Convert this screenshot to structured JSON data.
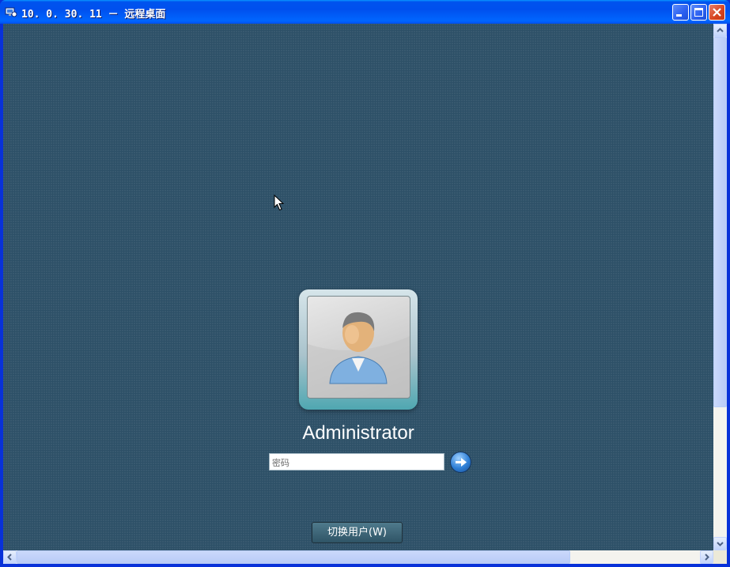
{
  "window": {
    "title": "10. 0. 30. 11 － 远程桌面",
    "icon": "remote-desktop-icon",
    "controls": [
      "minimize-icon",
      "maximize-icon",
      "close-icon"
    ]
  },
  "login": {
    "username": "Administrator",
    "password_placeholder": "密码",
    "password_value": "",
    "submit_icon": "arrow-right-icon",
    "switch_user_label": "切换用户(W)",
    "avatar_icon": "user-avatar-icon"
  },
  "colors": {
    "titlebar": "#0054e3",
    "desktop_background": "#2d5067",
    "close_button": "#d6431e"
  }
}
